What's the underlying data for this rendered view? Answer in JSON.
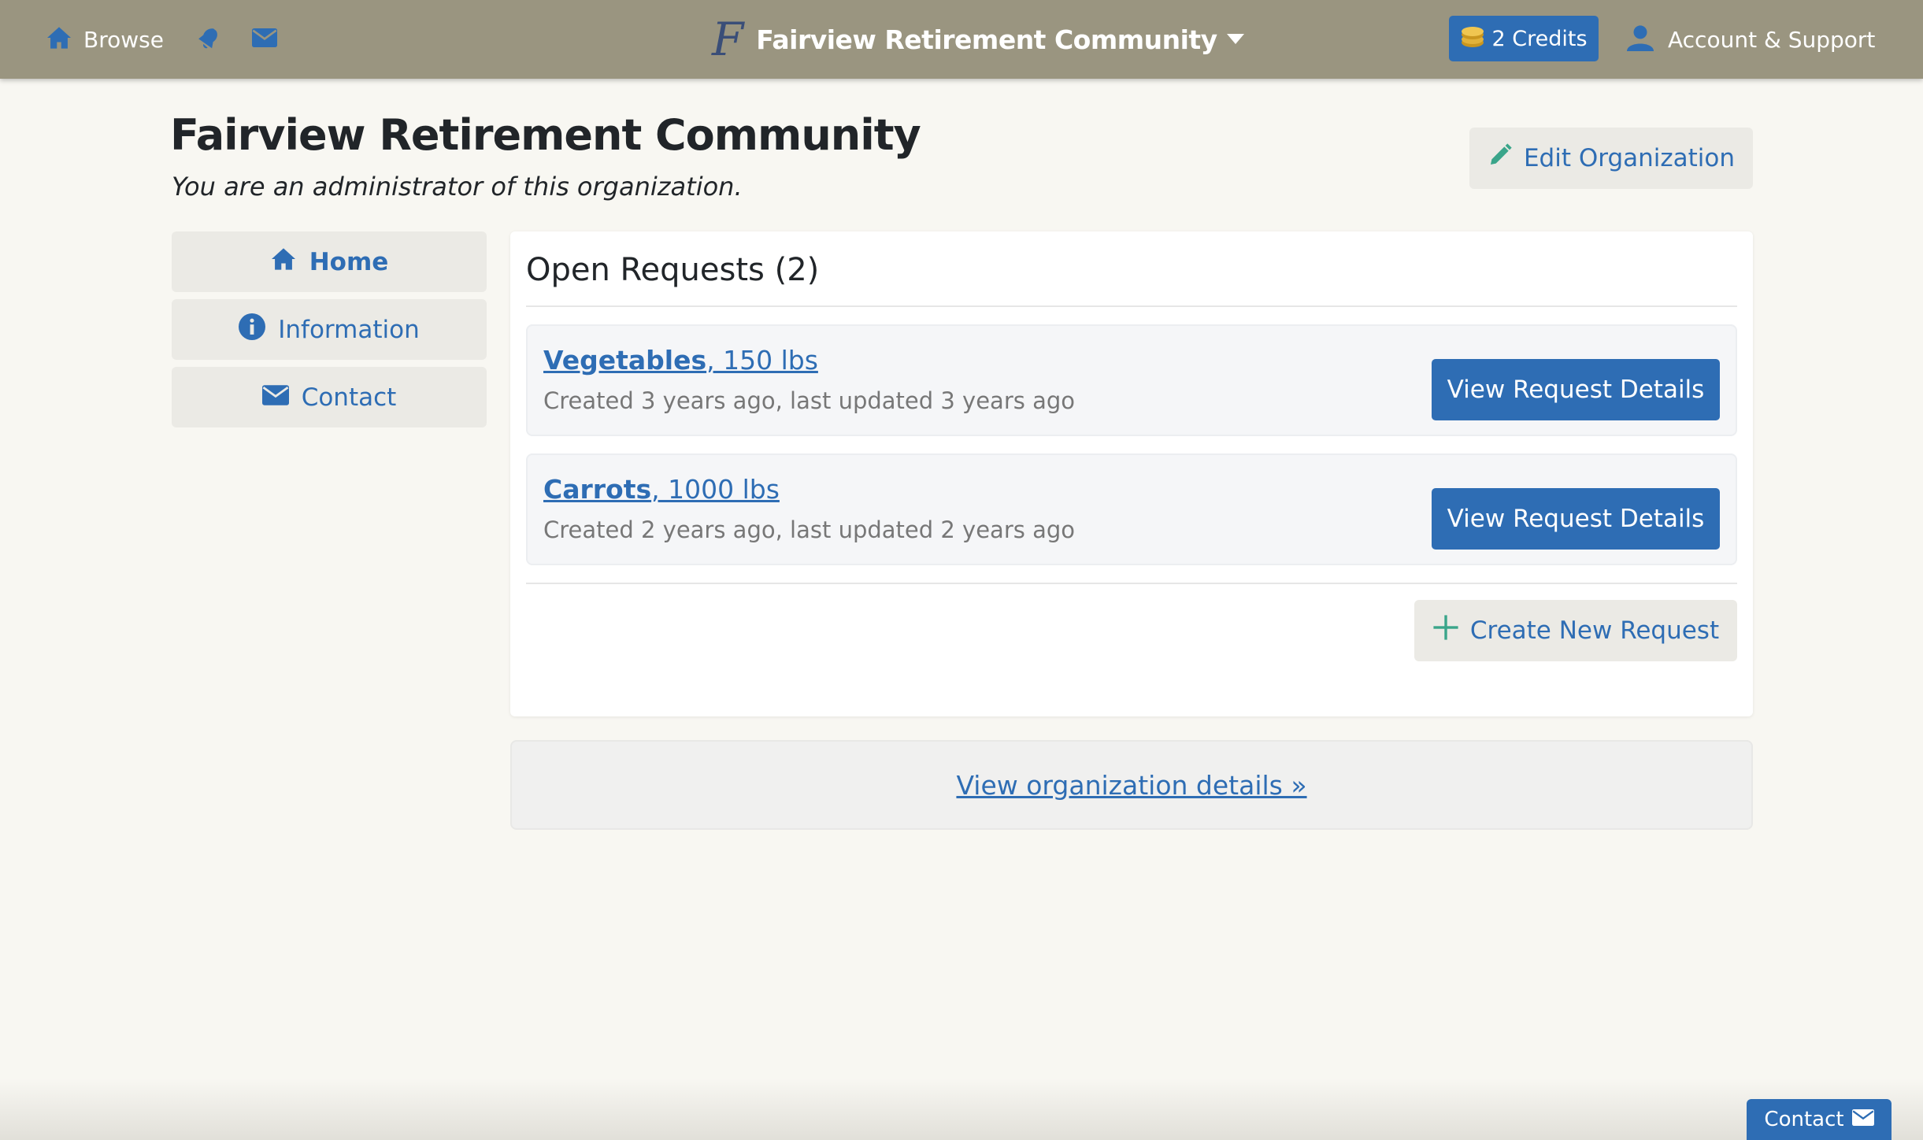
{
  "navbar": {
    "browse_label": "Browse",
    "logo_glyph": "F",
    "org_name": "Fairview Retirement Community",
    "credits_label": "2 Credits",
    "account_label": "Account & Support",
    "icons": [
      "home-icon",
      "bell-icon",
      "mail-icon",
      "caret-down-icon",
      "coins-icon",
      "user-icon"
    ]
  },
  "header": {
    "title": "Fairview Retirement Community",
    "subtitle": "You are an administrator of this organization.",
    "edit_label": "Edit Organization"
  },
  "sidenav": {
    "items": [
      {
        "label": "Home",
        "icon": "home-icon",
        "active": true
      },
      {
        "label": "Information",
        "icon": "info-icon",
        "active": false
      },
      {
        "label": "Contact",
        "icon": "mail-icon",
        "active": false
      }
    ]
  },
  "requests": {
    "title": "Open Requests (2)",
    "items": [
      {
        "item": "Vegetables",
        "amount": ", 150 lbs",
        "meta": "Created 3 years ago, last updated 3 years ago",
        "button": "View Request Details"
      },
      {
        "item": "Carrots",
        "amount": ", 1000 lbs",
        "meta": "Created 2 years ago, last updated 2 years ago",
        "button": "View Request Details"
      }
    ],
    "create_label": "Create New Request"
  },
  "details_link": "View organization details »",
  "footer": {
    "contact_label": "Contact"
  },
  "colors": {
    "navbar": "#9a9580",
    "primary": "#2e6db4",
    "accent_green": "#3aa58a",
    "page_bg": "#f8f7f2"
  }
}
